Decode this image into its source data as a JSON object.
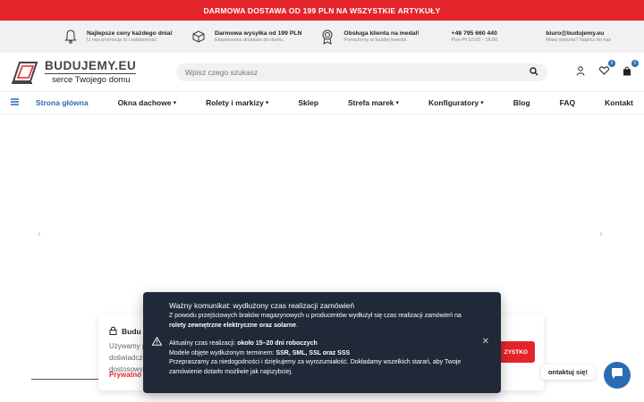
{
  "topbar": {
    "text": "DARMOWA DOSTAWA OD 199 PLN NA WSZYSTKIE ARTYKUŁY"
  },
  "infobar": [
    {
      "title": "Najlepsze ceny każdego dnia!",
      "sub": "U nas promocja to codzienność.",
      "icon": "bell-icon"
    },
    {
      "title": "Darmowa wysyłka od 199 PLN",
      "sub": "Ekspresowa dostawa do domu.",
      "icon": "package-icon"
    },
    {
      "title": "Obsługa klienta na medal!",
      "sub": "Pomożemy w każdej kwestii.",
      "icon": "medal-icon"
    },
    {
      "title": "+48 795 660 440",
      "sub": "Pon-Pt 10:00 - 18:00"
    },
    {
      "title": "biuro@budujemy.eu",
      "sub": "Masz pytania? Napisz do nas"
    }
  ],
  "logo": {
    "brand": "BUDUJEMY.EU",
    "tagline": "serce Twojego domu"
  },
  "search": {
    "placeholder": "Wpisz czego szukasz"
  },
  "header_icons": {
    "wishlist_count": "0",
    "cart_count": "0"
  },
  "nav": [
    {
      "label": "Strona główna",
      "dropdown": false,
      "active": true
    },
    {
      "label": "Okna dachowe",
      "dropdown": true
    },
    {
      "label": "Rolety i markizy",
      "dropdown": true
    },
    {
      "label": "Sklep",
      "dropdown": false
    },
    {
      "label": "Strefa marek",
      "dropdown": true
    },
    {
      "label": "Konfiguratory",
      "dropdown": true
    },
    {
      "label": "Blog",
      "dropdown": false
    },
    {
      "label": "FAQ",
      "dropdown": false
    },
    {
      "label": "Kontakt",
      "dropdown": false
    }
  ],
  "cookie": {
    "title": "Budu",
    "lines": [
      "Używamy p",
      "doświadcze",
      "dostosowy"
    ],
    "link": "Prywatno",
    "button": "ZYSTKO"
  },
  "contact": {
    "label": "ontaktuj się!"
  },
  "notice": {
    "title": "Ważny komunikat: wydłużony czas realizacji zamówień",
    "p1_a": "Z powodu przejściowych braków magazynowych u producentów wydłużył się czas realizacji zamówień na ",
    "p1_b": "rolety zewnętrzne elektryczne oraz solarne",
    "p1_c": ".",
    "time_label": "Aktualny czas realizacji: ",
    "time_value": "około 15–20 dni roboczych",
    "models_label": "Modele objęte wydłużonym terminem: ",
    "models_value": "SSR, SML, SSL oraz SSS",
    "p3": "Przepraszamy za niedogodności i dziękujemy za wyrozumiałość. Dokładamy wszelkich starań, aby Twoje zamówienie dotarło możliwie jak najszybciej."
  }
}
